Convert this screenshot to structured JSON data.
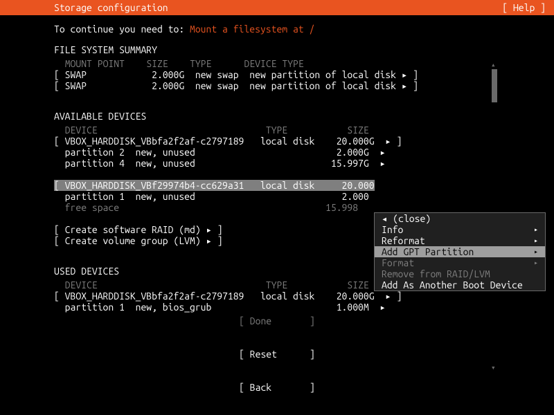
{
  "header": {
    "title": "Storage configuration",
    "help": "[ Help ]"
  },
  "instruction_prefix": "To continue you need to: ",
  "instruction_link": "Mount a filesystem at /",
  "sections": {
    "file_system_summary": {
      "title": "FILE SYSTEM SUMMARY",
      "columns": {
        "c1": "MOUNT POINT",
        "c2": "SIZE",
        "c3": "TYPE",
        "c4": "DEVICE TYPE"
      },
      "rows": [
        {
          "mount": "[ SWAP",
          "size": "2.000G",
          "type": "new swap",
          "dev": "new partition of local disk ▸ ]"
        },
        {
          "mount": "[ SWAP",
          "size": "2.000G",
          "type": "new swap",
          "dev": "new partition of local disk ▸ ]"
        }
      ]
    },
    "available_devices": {
      "title": "AVAILABLE DEVICES",
      "columns": {
        "c1": "DEVICE",
        "c2": "TYPE",
        "c3": "SIZE"
      },
      "block1": {
        "dev": "[ VBOX_HARDDISK_VBbfa2f2af-c2797189",
        "type": "local disk",
        "size": "20.000G",
        "tail": "▸ ]",
        "p2": {
          "label": "  partition 2  new, unused",
          "size": "2.000G",
          "tail": "▸"
        },
        "p4": {
          "label": "  partition 4  new, unused",
          "size": "15.997G",
          "tail": "▸"
        }
      },
      "block2": {
        "dev_sel": "[ VBOX_HARDDISK_VBf29974b4-cc629a31   local disk     20.000",
        "p1": {
          "label": "  partition 1  new, unused",
          "size": "2.000"
        },
        "free": {
          "label": "  free space",
          "size": "15.998"
        }
      },
      "actions": {
        "raid": "[ Create software RAID (md) ▸ ]",
        "lvm": "[ Create volume group (LVM) ▸ ]"
      }
    },
    "used_devices": {
      "title": "USED DEVICES",
      "columns": {
        "c1": "DEVICE",
        "c2": "TYPE",
        "c3": "SIZE"
      },
      "dev": "[ VBOX_HARDDISK_VBbfa2f2af-c2797189",
      "type": "local disk",
      "size": "20.000G",
      "tail": "▸ ]",
      "p1": {
        "label": "  partition 1  new, bios_grub",
        "size": "1.000M",
        "tail": "▸"
      }
    }
  },
  "popup": {
    "close": "◂ (close)",
    "info": "Info",
    "reformat": "Reformat",
    "addgpt": "Add GPT Partition",
    "format": "Format",
    "remove": "Remove from RAID/LVM",
    "addboot": "Add As Another Boot Device"
  },
  "buttons": {
    "done": "[ Done       ]",
    "reset": "[ Reset      ]",
    "back": "[ Back       ]"
  }
}
